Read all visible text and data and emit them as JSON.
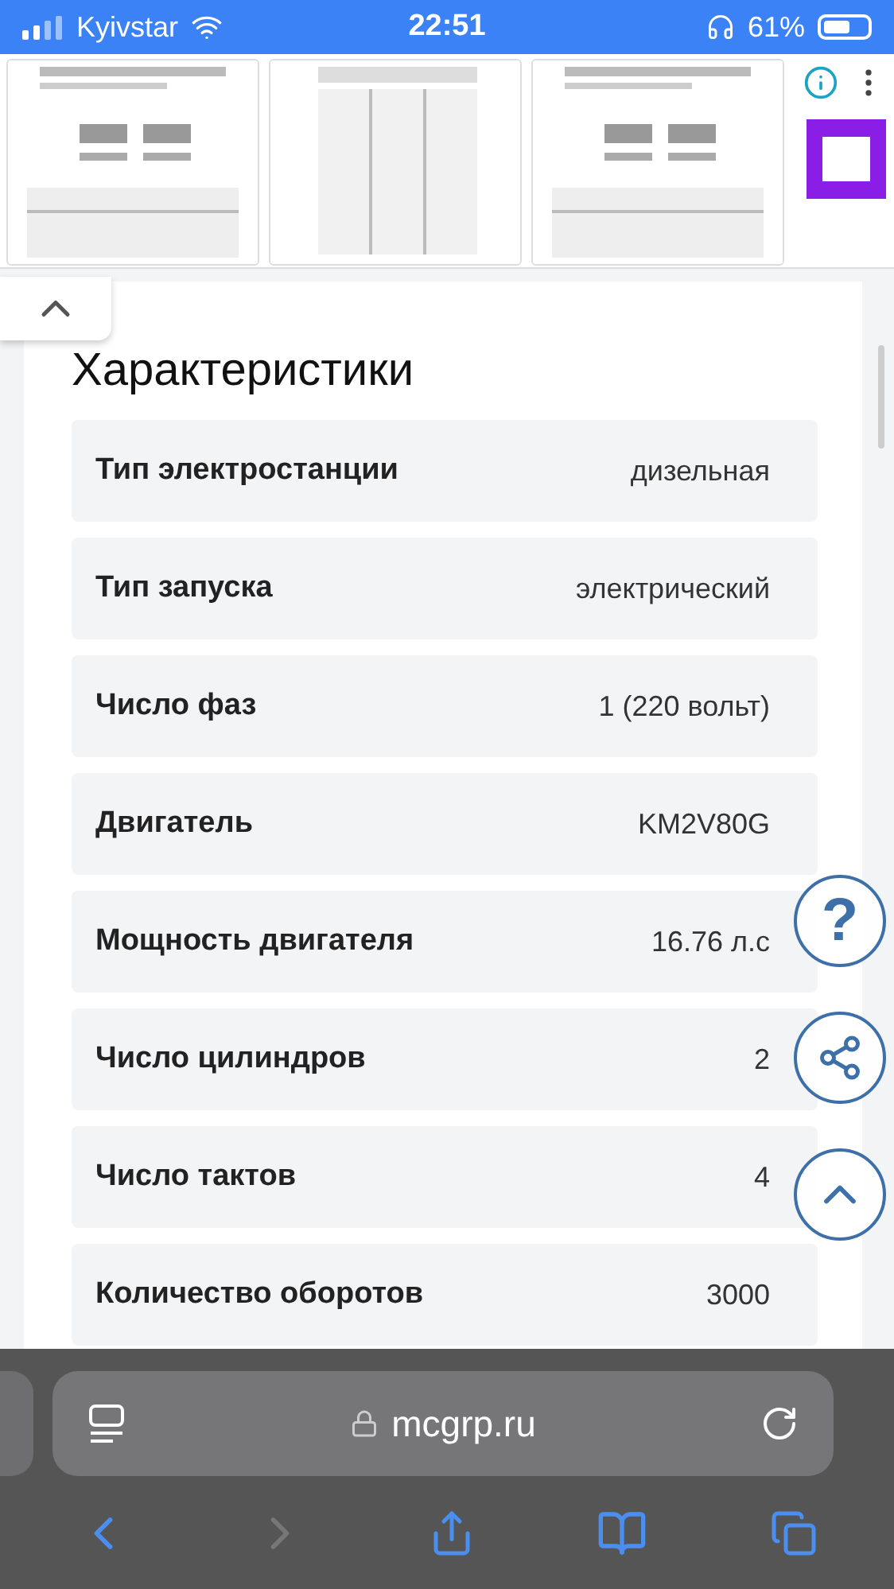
{
  "status_bar": {
    "carrier": "Kyivstar",
    "time": "22:51",
    "battery": "61%"
  },
  "specs": {
    "title": "Характеристики",
    "rows": [
      {
        "label": "Тип электростанции",
        "value": "дизельная"
      },
      {
        "label": "Тип запуска",
        "value": "электрический"
      },
      {
        "label": "Число фаз",
        "value": "1 (220 вольт)"
      },
      {
        "label": "Двигатель",
        "value": "KM2V80G"
      },
      {
        "label": "Мощность двигателя",
        "value": "16.76 л.с"
      },
      {
        "label": "Число цилиндров",
        "value": "2"
      },
      {
        "label": "Число тактов",
        "value": "4"
      },
      {
        "label": "Количество оборотов",
        "value": "3000"
      }
    ]
  },
  "floating": {
    "help_label": "?"
  },
  "browser": {
    "url": "mcgrp.ru"
  }
}
